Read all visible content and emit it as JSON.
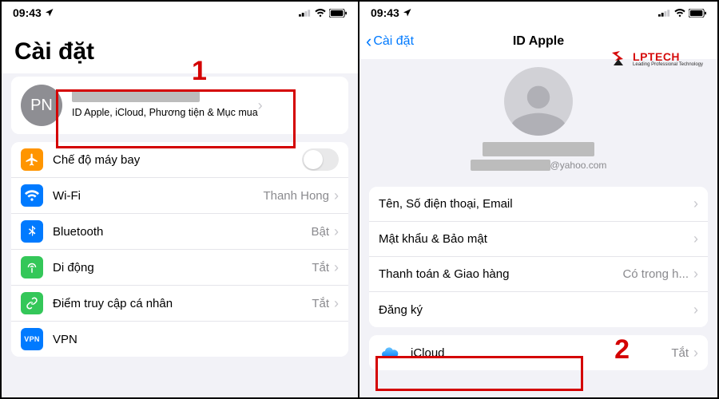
{
  "status": {
    "time": "09:43"
  },
  "annotations": {
    "n1": "1",
    "n2": "2"
  },
  "watermark": {
    "brand": "LPTECH",
    "tagline": "Leading Professional Technology"
  },
  "left": {
    "title": "Cài đặt",
    "account": {
      "initials": "PN",
      "subtitle": "ID Apple, iCloud, Phương tiện & Mục mua"
    },
    "rows": {
      "airplane": {
        "label": "Chế độ máy bay"
      },
      "wifi": {
        "label": "Wi-Fi",
        "value": "Thanh Hong"
      },
      "bt": {
        "label": "Bluetooth",
        "value": "Bật"
      },
      "cell": {
        "label": "Di động",
        "value": "Tắt"
      },
      "hotspot": {
        "label": "Điểm truy cập cá nhân",
        "value": "Tắt"
      },
      "vpn": {
        "label": "VPN",
        "icon_text": "VPN"
      }
    }
  },
  "right": {
    "back": "Cài đặt",
    "title": "ID Apple",
    "email_suffix": "@yahoo.com",
    "rows": {
      "name": {
        "label": "Tên, Số điện thoại, Email"
      },
      "pwd": {
        "label": "Mật khẩu & Bảo mật"
      },
      "pay": {
        "label": "Thanh toán & Giao hàng",
        "value": "Có trong h..."
      },
      "subs": {
        "label": "Đăng ký"
      },
      "icloud": {
        "label": "iCloud",
        "value": "Tắt"
      }
    }
  }
}
